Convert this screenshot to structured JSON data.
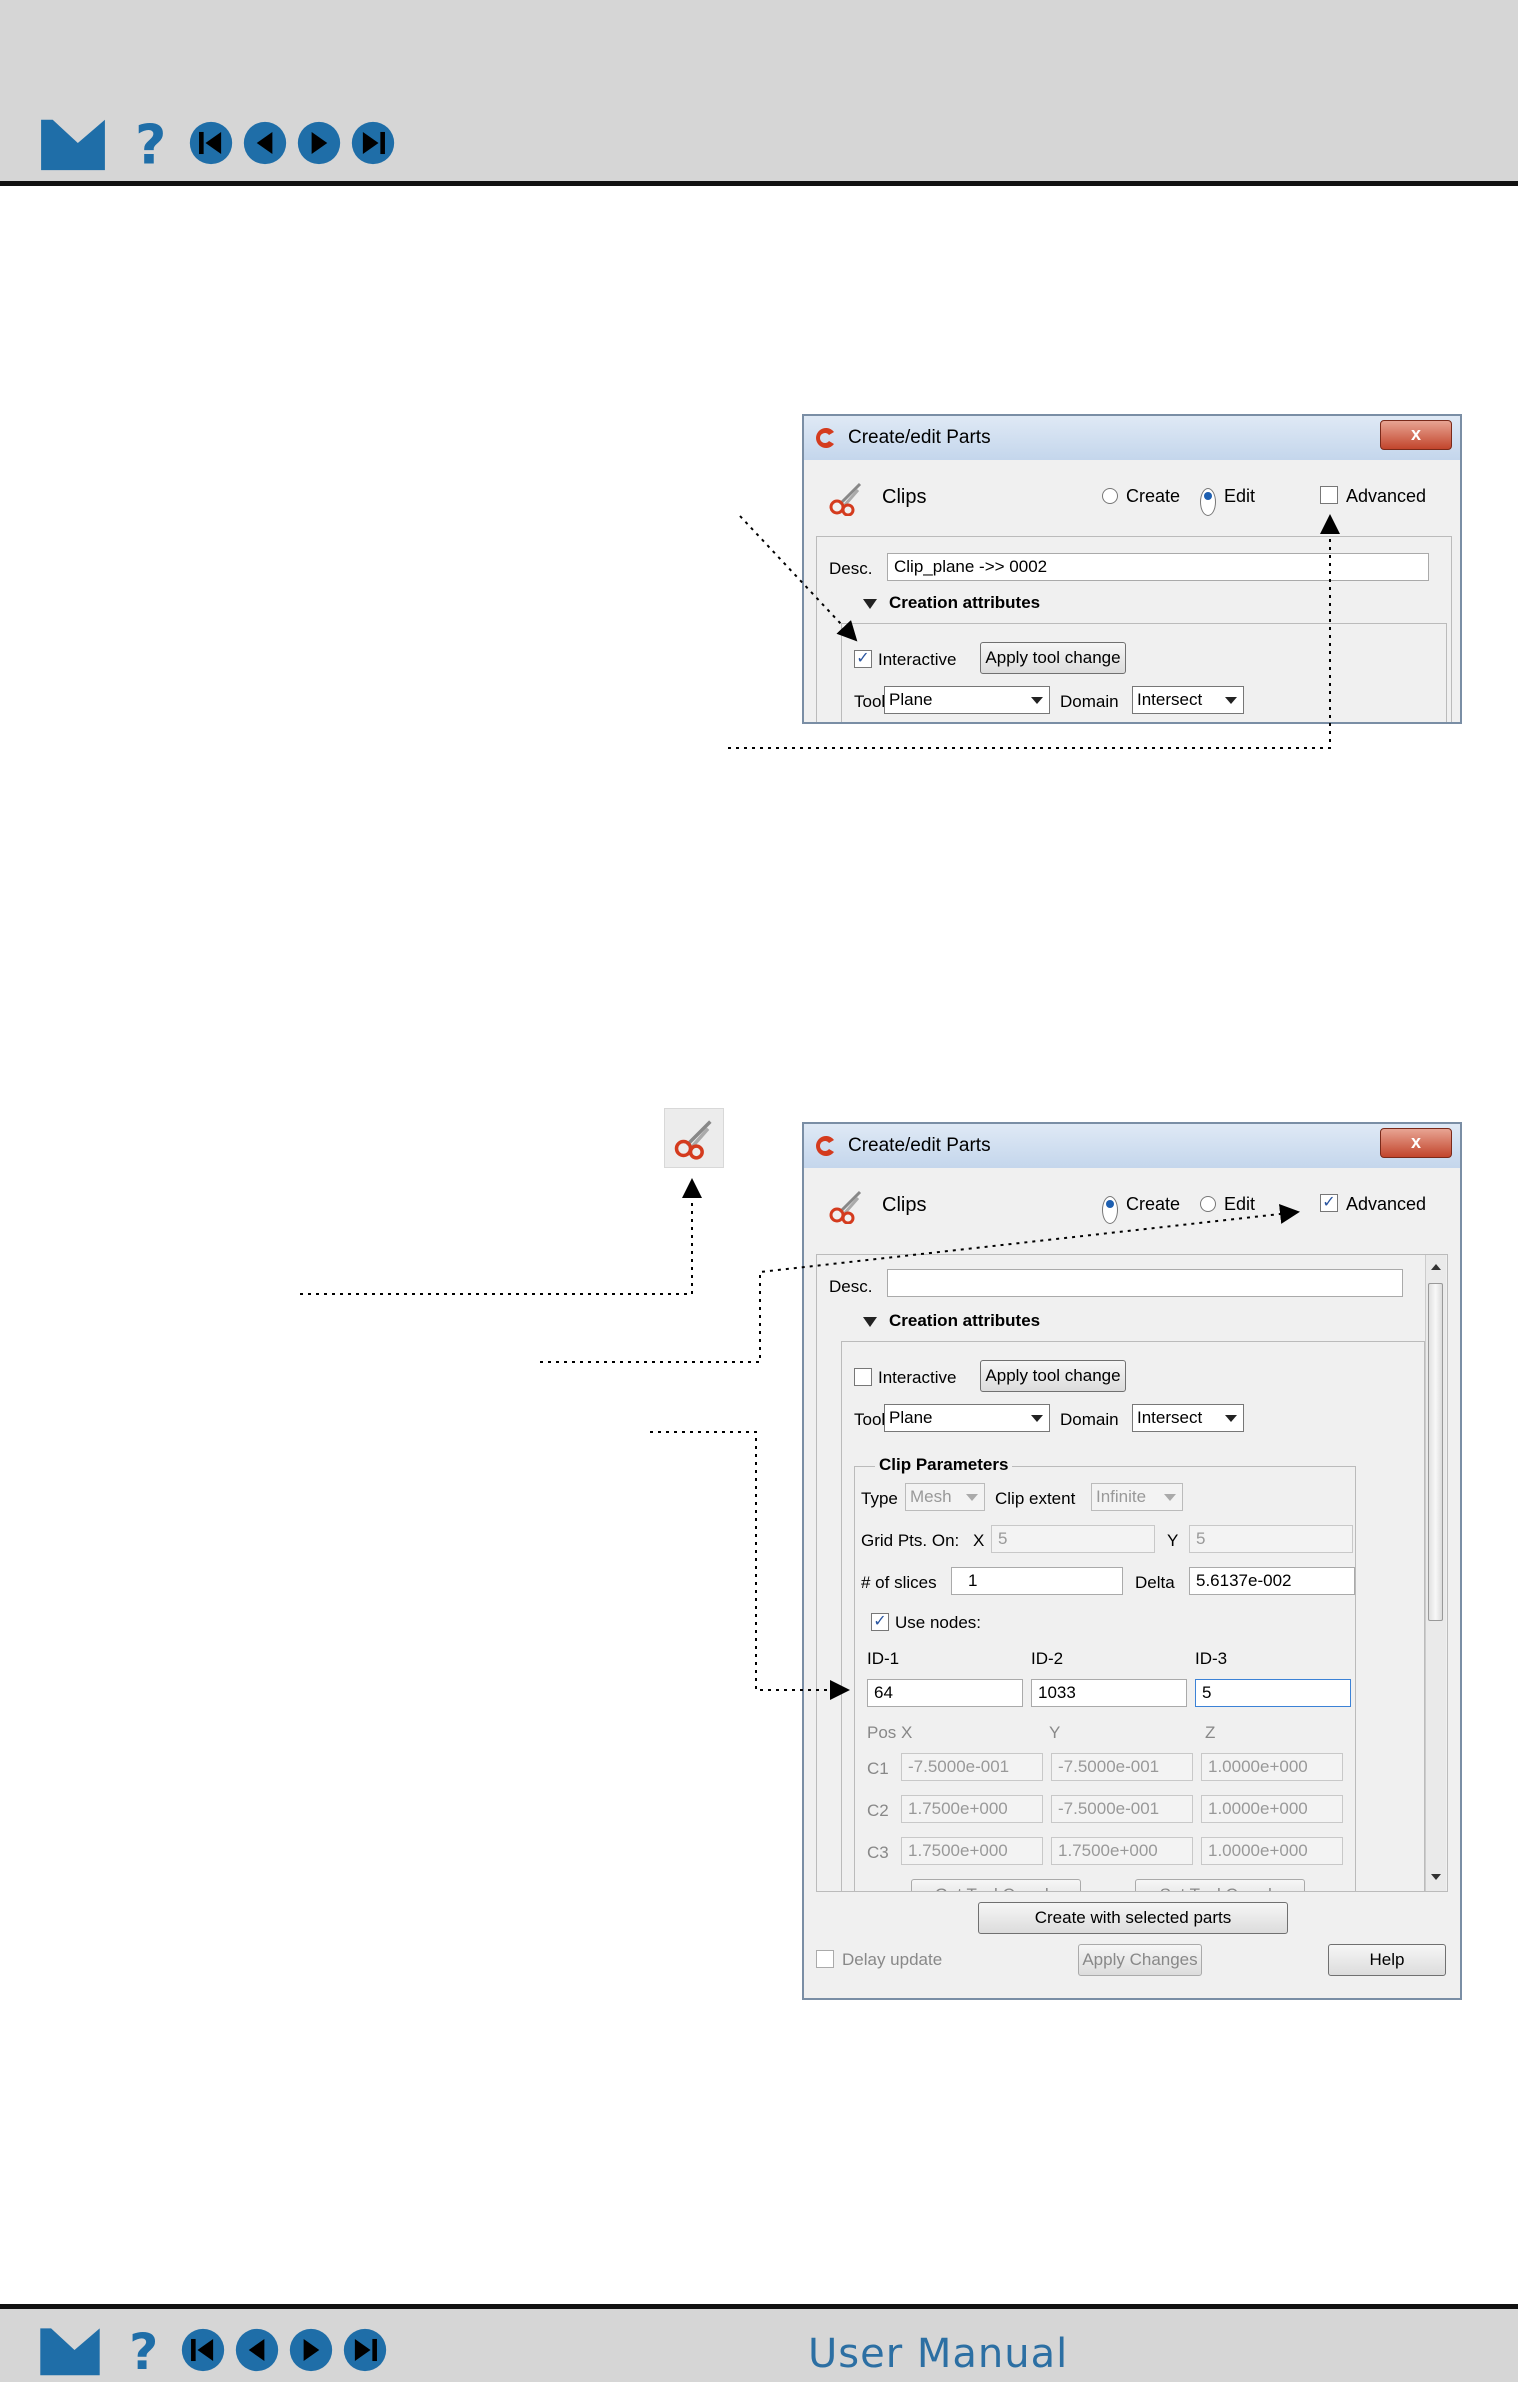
{
  "footer": {
    "title": "User Manual"
  },
  "nav": {
    "home_icon": "home-icon",
    "help_icon": "help-icon",
    "first_icon": "first-page-icon",
    "prev_icon": "previous-page-icon",
    "next_icon": "next-page-icon",
    "last_icon": "last-page-icon",
    "accent": "#1f6ea8"
  },
  "dialog1": {
    "title": "Create/edit Parts",
    "close": "x",
    "part_type": "Clips",
    "create_label": "Create",
    "edit_label": "Edit",
    "mode": "Edit",
    "advanced_label": "Advanced",
    "advanced_checked": false,
    "desc_label": "Desc.",
    "desc_value": "Clip_plane ->> 0002",
    "section_title": "Creation attributes",
    "interactive_label": "Interactive",
    "interactive_checked": true,
    "apply_tool_label": "Apply tool change",
    "tool_label": "Tool",
    "tool_value": "Plane",
    "domain_label": "Domain",
    "domain_value": "Intersect"
  },
  "dialog2": {
    "title": "Create/edit Parts",
    "close": "x",
    "part_type": "Clips",
    "create_label": "Create",
    "edit_label": "Edit",
    "mode": "Create",
    "advanced_label": "Advanced",
    "advanced_checked": true,
    "desc_label": "Desc.",
    "desc_value": "",
    "section_title": "Creation attributes",
    "interactive_label": "Interactive",
    "interactive_checked": false,
    "apply_tool_label": "Apply tool change",
    "tool_label": "Tool",
    "tool_value": "Plane",
    "domain_label": "Domain",
    "domain_value": "Intersect",
    "clip_params_title": "Clip Parameters",
    "type_label": "Type",
    "type_value": "Mesh",
    "clip_extent_label": "Clip extent",
    "clip_extent_value": "Infinite",
    "grid_pts_label": "Grid Pts. On:",
    "grid_x_label": "X",
    "grid_x_value": "5",
    "grid_y_label": "Y",
    "grid_y_value": "5",
    "slices_label": "# of slices",
    "slices_value": "1",
    "delta_label": "Delta",
    "delta_value": "5.6137e-002",
    "use_nodes_label": "Use nodes:",
    "use_nodes_checked": true,
    "id_labels": [
      "ID-1",
      "ID-2",
      "ID-3"
    ],
    "id_values": [
      "64",
      "1033",
      "5"
    ],
    "pos_label": "Pos",
    "axis_labels": [
      "X",
      "Y",
      "Z"
    ],
    "coord_rows": [
      {
        "label": "C1",
        "x": "-7.5000e-001",
        "y": "-7.5000e-001",
        "z": "1.0000e+000"
      },
      {
        "label": "C2",
        "x": "1.7500e+000",
        "y": "-7.5000e-001",
        "z": "1.0000e+000"
      },
      {
        "label": "C3",
        "x": "1.7500e+000",
        "y": "1.7500e+000",
        "z": "1.0000e+000"
      }
    ],
    "get_tool_coords_label": "Get Tool Coords",
    "set_tool_coords_label": "Set Tool Coords",
    "create_selected_label": "Create with selected parts",
    "delay_update_label": "Delay update",
    "apply_changes_label": "Apply Changes",
    "help_label": "Help"
  },
  "clip_tool_icon": "scissors-icon"
}
